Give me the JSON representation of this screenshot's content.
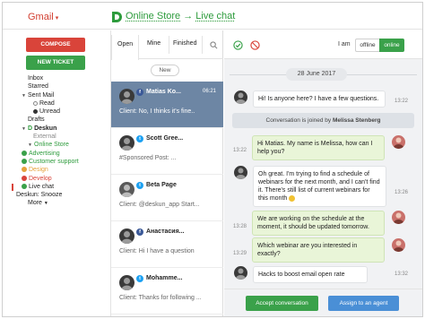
{
  "gmail": {
    "title": "Gmail"
  },
  "app": {
    "store": "Online Store",
    "arrow": "→",
    "section": "Live chat"
  },
  "leftnav": {
    "compose": "COMPOSE",
    "new_ticket": "NEW TICKET",
    "items": [
      {
        "label": "Inbox"
      },
      {
        "label": "Starred"
      },
      {
        "label": "Sent Mail"
      },
      {
        "label": "Read"
      },
      {
        "label": "Unread"
      },
      {
        "label": "Drafts"
      },
      {
        "label": "Deskun"
      },
      {
        "label": "External"
      },
      {
        "label": "Online Store"
      },
      {
        "label": "Advertising",
        "color": "#3aa14a"
      },
      {
        "label": "Customer support",
        "color": "#3aa14a"
      },
      {
        "label": "Design",
        "color": "#e6a23c"
      },
      {
        "label": "Develop",
        "color": "#d9443a"
      },
      {
        "label": "Live chat"
      },
      {
        "label": "Deskun: Snooze"
      },
      {
        "label": "More"
      }
    ],
    "badges": [
      "4",
      "4",
      "4",
      "4"
    ]
  },
  "conv_tabs": {
    "open": "Open",
    "mine": "Mine",
    "finished": "Finished"
  },
  "new_label": "New",
  "conversations": [
    {
      "name": "Matias Ko...",
      "time": "06:21",
      "msg": "Client: No, I thinks it's fine..",
      "network": "f",
      "net_color": "#3b5998"
    },
    {
      "name": "Scott Gree...",
      "time": "",
      "msg": "#Sponsored Post: ...",
      "network": "t",
      "net_color": "#1da1f2"
    },
    {
      "name": "Beta Page",
      "time": "",
      "msg": "Client: @deskun_app Start...",
      "network": "t",
      "net_color": "#1da1f2"
    },
    {
      "name": "Анастасия...",
      "time": "",
      "msg": "Client: Hi I have a question",
      "network": "f",
      "net_color": "#3b5998"
    },
    {
      "name": "Mohamme...",
      "time": "",
      "msg": "Client: Thanks for following ...",
      "network": "t",
      "net_color": "#1da1f2"
    }
  ],
  "chat": {
    "i_am": "I am",
    "offline": "offline",
    "online": "online",
    "date": "28 June 2017",
    "messages": [
      {
        "text": "Hi! Is anyone here? I have a few questions.",
        "time": "13:22"
      },
      {
        "text": "Conversation is joined by ",
        "bold": "Melissa Stenberg"
      },
      {
        "text": "Hi Matias. My name is Melissa, how can I help you?",
        "time": "13:22"
      },
      {
        "text": "Oh great. I'm trying to find a schedule of webinars for the next month, and I can't find it. There's still list of current webinars for this month",
        "time": "13:26"
      },
      {
        "text": "We are working on the schedule at the moment, it should be updated tomorrow.",
        "time": "13:28"
      },
      {
        "text": "Which webinar are you interested in exactly?",
        "time": "13:29"
      },
      {
        "text": "Hacks to boost email open rate",
        "time": "13:32"
      }
    ],
    "accept": "Accept conversation",
    "assign": "Assign to an agent"
  }
}
